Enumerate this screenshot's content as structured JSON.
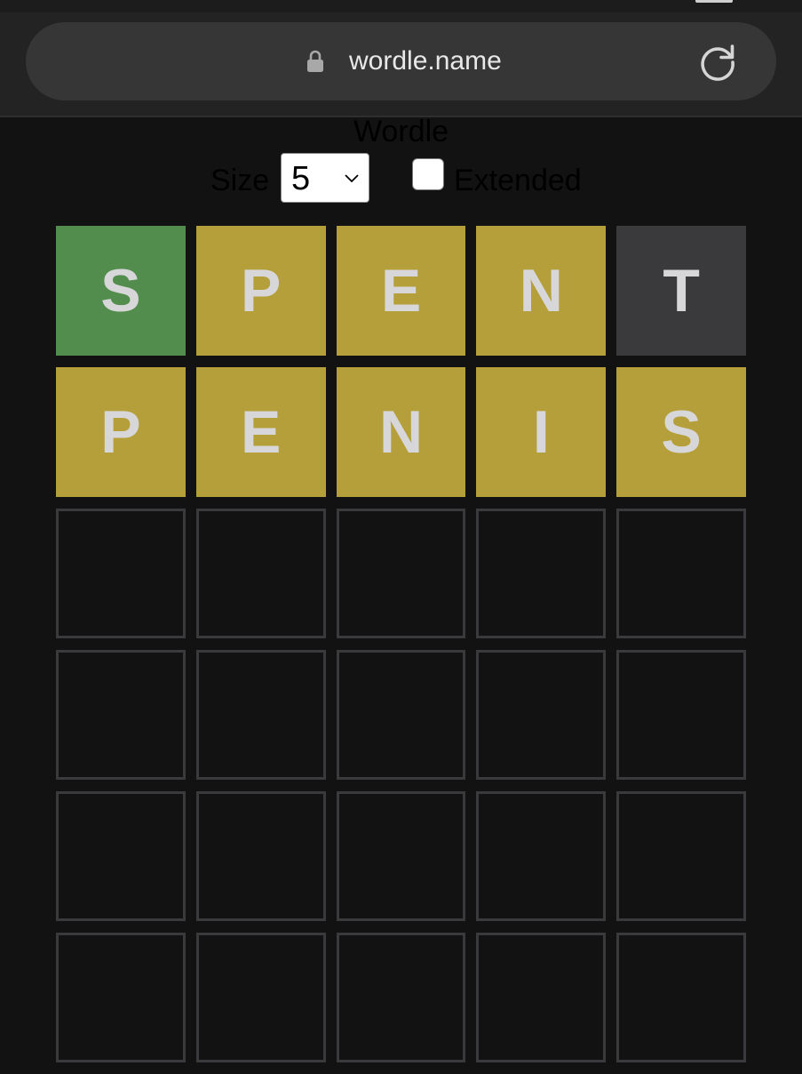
{
  "browser": {
    "url": "wordle.name"
  },
  "header": {
    "title": "Wordle",
    "size_label": "Size",
    "size_value": "5",
    "extended_label": "Extended",
    "extended_checked": false
  },
  "colors": {
    "correct": "#538d4e",
    "present": "#b59f3b",
    "absent": "#3a3a3c",
    "empty_border": "#3a3a3c",
    "background": "#121212"
  },
  "board": {
    "rows": [
      {
        "tiles": [
          {
            "letter": "S",
            "state": "correct"
          },
          {
            "letter": "P",
            "state": "present"
          },
          {
            "letter": "E",
            "state": "present"
          },
          {
            "letter": "N",
            "state": "present"
          },
          {
            "letter": "T",
            "state": "absent"
          }
        ]
      },
      {
        "tiles": [
          {
            "letter": "P",
            "state": "present"
          },
          {
            "letter": "E",
            "state": "present"
          },
          {
            "letter": "N",
            "state": "present"
          },
          {
            "letter": "I",
            "state": "present"
          },
          {
            "letter": "S",
            "state": "present"
          }
        ]
      },
      {
        "tiles": [
          {
            "letter": "",
            "state": "empty"
          },
          {
            "letter": "",
            "state": "empty"
          },
          {
            "letter": "",
            "state": "empty"
          },
          {
            "letter": "",
            "state": "empty"
          },
          {
            "letter": "",
            "state": "empty"
          }
        ]
      },
      {
        "tiles": [
          {
            "letter": "",
            "state": "empty"
          },
          {
            "letter": "",
            "state": "empty"
          },
          {
            "letter": "",
            "state": "empty"
          },
          {
            "letter": "",
            "state": "empty"
          },
          {
            "letter": "",
            "state": "empty"
          }
        ]
      },
      {
        "tiles": [
          {
            "letter": "",
            "state": "empty"
          },
          {
            "letter": "",
            "state": "empty"
          },
          {
            "letter": "",
            "state": "empty"
          },
          {
            "letter": "",
            "state": "empty"
          },
          {
            "letter": "",
            "state": "empty"
          }
        ]
      },
      {
        "tiles": [
          {
            "letter": "",
            "state": "empty"
          },
          {
            "letter": "",
            "state": "empty"
          },
          {
            "letter": "",
            "state": "empty"
          },
          {
            "letter": "",
            "state": "empty"
          },
          {
            "letter": "",
            "state": "empty"
          }
        ]
      }
    ]
  }
}
